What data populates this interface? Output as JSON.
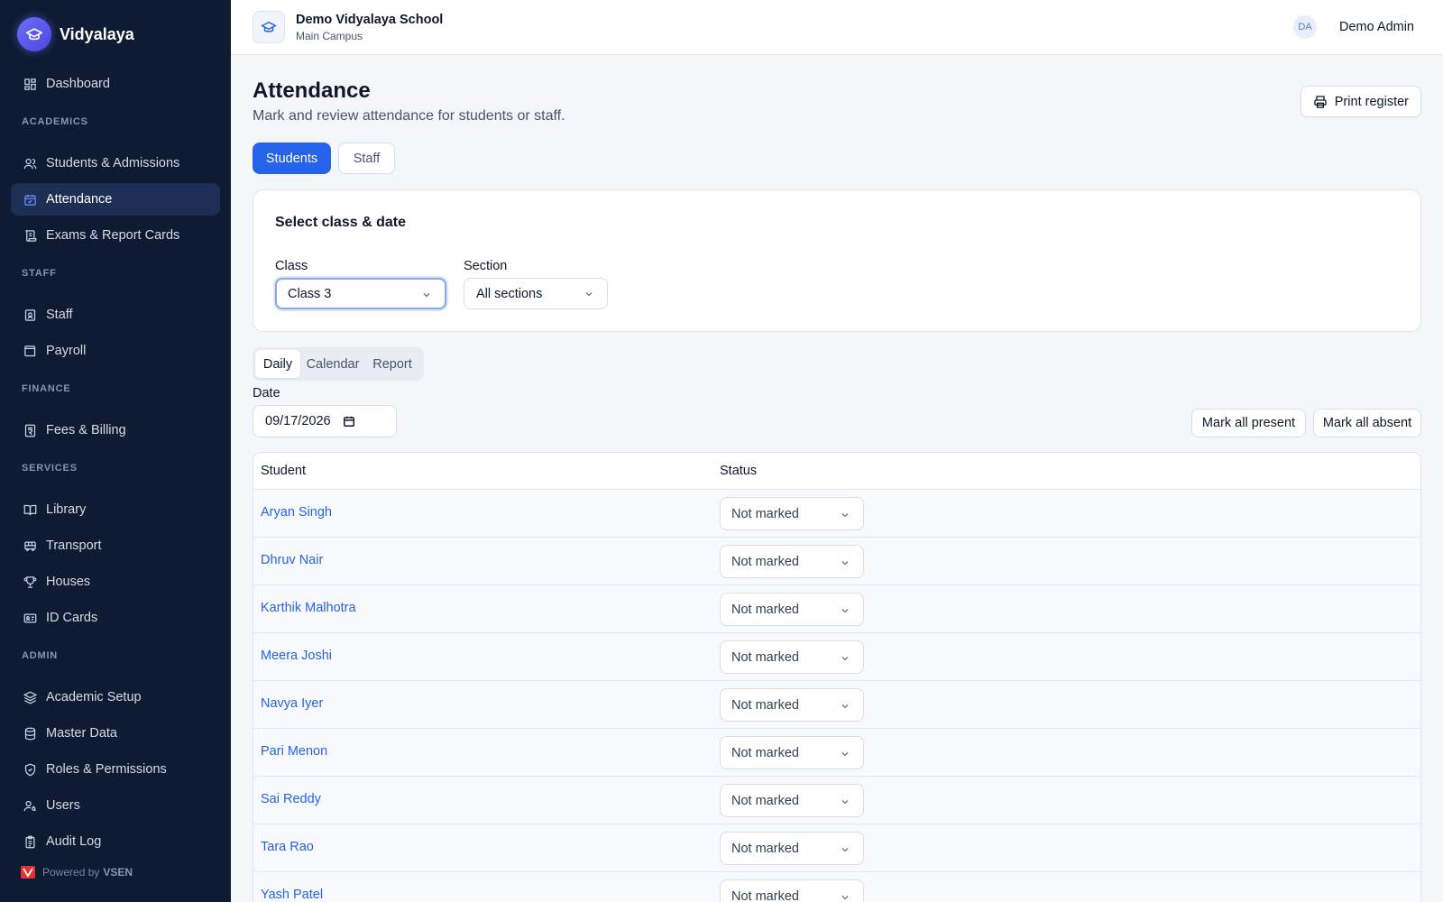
{
  "brand": {
    "name": "Vidyalaya"
  },
  "sidebar": {
    "dashboard": "Dashboard",
    "sections": {
      "academics": "ACADEMICS",
      "staff": "STAFF",
      "finance": "FINANCE",
      "services": "SERVICES",
      "admin": "ADMIN"
    },
    "items": {
      "students": "Students & Admissions",
      "attendance": "Attendance",
      "exams": "Exams & Report Cards",
      "staff": "Staff",
      "payroll": "Payroll",
      "fees": "Fees & Billing",
      "library": "Library",
      "transport": "Transport",
      "houses": "Houses",
      "idcards": "ID Cards",
      "academic_setup": "Academic Setup",
      "master_data": "Master Data",
      "roles": "Roles & Permissions",
      "users": "Users",
      "audit": "Audit Log"
    },
    "active": "Attendance",
    "powered_prefix": "Powered by",
    "powered_brand": "VSEN"
  },
  "header": {
    "school_name": "Demo Vidyalaya School",
    "campus": "Main Campus",
    "user_initials": "DA",
    "user_name": "Demo Admin"
  },
  "page": {
    "title": "Attendance",
    "subtitle": "Mark and review attendance for students or staff.",
    "print_label": "Print register",
    "segments": {
      "students": "Students",
      "staff": "Staff",
      "selected": "Students"
    }
  },
  "filter_card": {
    "title": "Select class & date",
    "class_label": "Class",
    "class_value": "Class 3",
    "section_label": "Section",
    "section_value": "All sections"
  },
  "view_tabs": {
    "daily": "Daily",
    "calendar": "Calendar",
    "report": "Report",
    "selected": "Daily"
  },
  "date": {
    "label": "Date",
    "value": "09/17/2026"
  },
  "actions": {
    "mark_present": "Mark all present",
    "mark_absent": "Mark all absent"
  },
  "table": {
    "headers": {
      "student": "Student",
      "status": "Status"
    },
    "rows": [
      {
        "name": "Aryan Singh",
        "status": "Not marked"
      },
      {
        "name": "Dhruv Nair",
        "status": "Not marked"
      },
      {
        "name": "Karthik Malhotra",
        "status": "Not marked"
      },
      {
        "name": "Meera Joshi",
        "status": "Not marked"
      },
      {
        "name": "Navya Iyer",
        "status": "Not marked"
      },
      {
        "name": "Pari Menon",
        "status": "Not marked"
      },
      {
        "name": "Sai Reddy",
        "status": "Not marked"
      },
      {
        "name": "Tara Rao",
        "status": "Not marked"
      },
      {
        "name": "Yash Patel",
        "status": "Not marked"
      }
    ]
  },
  "colors": {
    "sidebar_bg": "#0f1b33",
    "sidebar_active": "#1d2f55",
    "accent": "#2563eb",
    "page_bg": "#f4f6fa"
  }
}
